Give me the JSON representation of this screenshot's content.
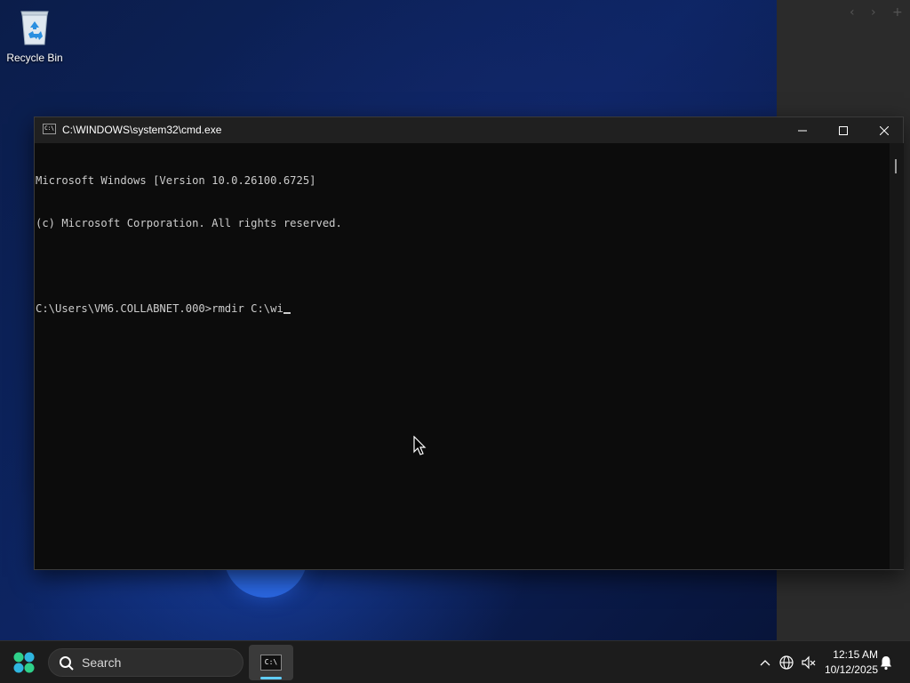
{
  "desktop": {
    "recycle_bin_label": "Recycle Bin",
    "side_panel_icons": [
      "chevron-left-icon",
      "chevron-right-icon",
      "plus-icon"
    ]
  },
  "cmd_window": {
    "title": "C:\\WINDOWS\\system32\\cmd.exe",
    "app_icon_text": "C:\\",
    "controls": [
      "minimize-icon",
      "maximize-icon",
      "close-icon"
    ],
    "lines": [
      "Microsoft Windows [Version 10.0.26100.6725]",
      "(c) Microsoft Corporation. All rights reserved.",
      "",
      "C:\\Users\\VM6.COLLABNET.000>rmdir C:\\wi"
    ],
    "background_color": "#0c0c0c",
    "text_color": "#cccccc"
  },
  "taskbar": {
    "search_placeholder": "Search",
    "running_app_icon_text": "C:\\",
    "accent_color": "#60cdff",
    "clock": {
      "time": "12:15 AM",
      "date": "10/12/2025"
    }
  }
}
